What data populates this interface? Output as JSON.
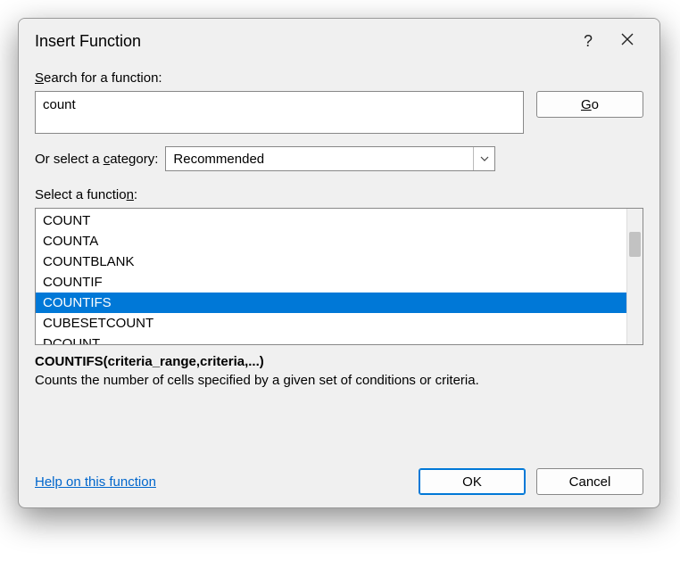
{
  "title": "Insert Function",
  "help_symbol": "?",
  "labels": {
    "search_prefix": "S",
    "search_rest": "earch for a function:",
    "category_prefix": "Or select a ",
    "category_u": "c",
    "category_rest": "ategory:",
    "select_prefix": "Select a functio",
    "select_u": "n",
    "select_rest": ":"
  },
  "search": {
    "value": "count"
  },
  "go": {
    "u": "G",
    "rest": "o"
  },
  "category": {
    "selected": "Recommended"
  },
  "functions": [
    "COUNT",
    "COUNTA",
    "COUNTBLANK",
    "COUNTIF",
    "COUNTIFS",
    "CUBESETCOUNT",
    "DCOUNT"
  ],
  "selected_index": 4,
  "syntax": "COUNTIFS(criteria_range,criteria,...)",
  "description": "Counts the number of cells specified by a given set of conditions or criteria.",
  "help_link": "Help on this function",
  "buttons": {
    "ok": "OK",
    "cancel": "Cancel"
  }
}
